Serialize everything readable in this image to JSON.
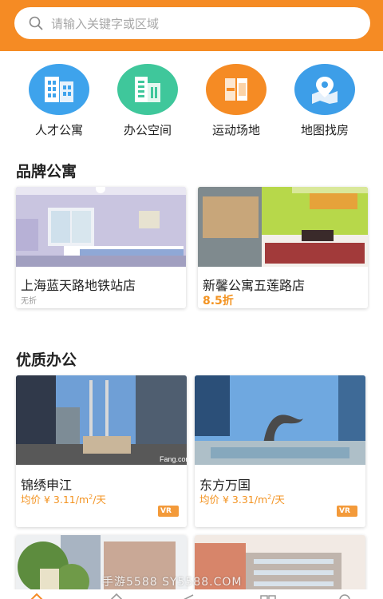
{
  "search": {
    "placeholder": "请输入关键字或区域"
  },
  "categories": [
    {
      "label": "人才公寓",
      "icon": "apartment-building-icon",
      "color": "#3ea3ec"
    },
    {
      "label": "办公空间",
      "icon": "office-building-icon",
      "color": "#3fc79b"
    },
    {
      "label": "运动场地",
      "icon": "sports-venue-icon",
      "color": "#f58b24"
    },
    {
      "label": "地图找房",
      "icon": "map-pin-icon",
      "color": "#3d9ee8"
    }
  ],
  "brand_apartments": {
    "title": "品牌公寓",
    "items": [
      {
        "name": "上海蓝天路地铁站店",
        "sub": "无折"
      },
      {
        "name": "新馨公寓五莲路店",
        "discount": "8.5折"
      }
    ]
  },
  "quality_office": {
    "title": "优质办公",
    "items": [
      {
        "name": "锦绣申江",
        "price_prefix": "均价 ¥ 3.11/m",
        "price_exp": "2",
        "price_suffix": "/天",
        "badge": "VR"
      },
      {
        "name": "东方万国",
        "price_prefix": "均价 ¥ 3.31/m",
        "price_exp": "2",
        "price_suffix": "/天",
        "badge": "VR"
      }
    ]
  },
  "photo_credit": "Fang.com",
  "watermark": "手游5588 SY5588.COM",
  "colors": {
    "accent": "#f58b24",
    "price": "#f39321"
  }
}
